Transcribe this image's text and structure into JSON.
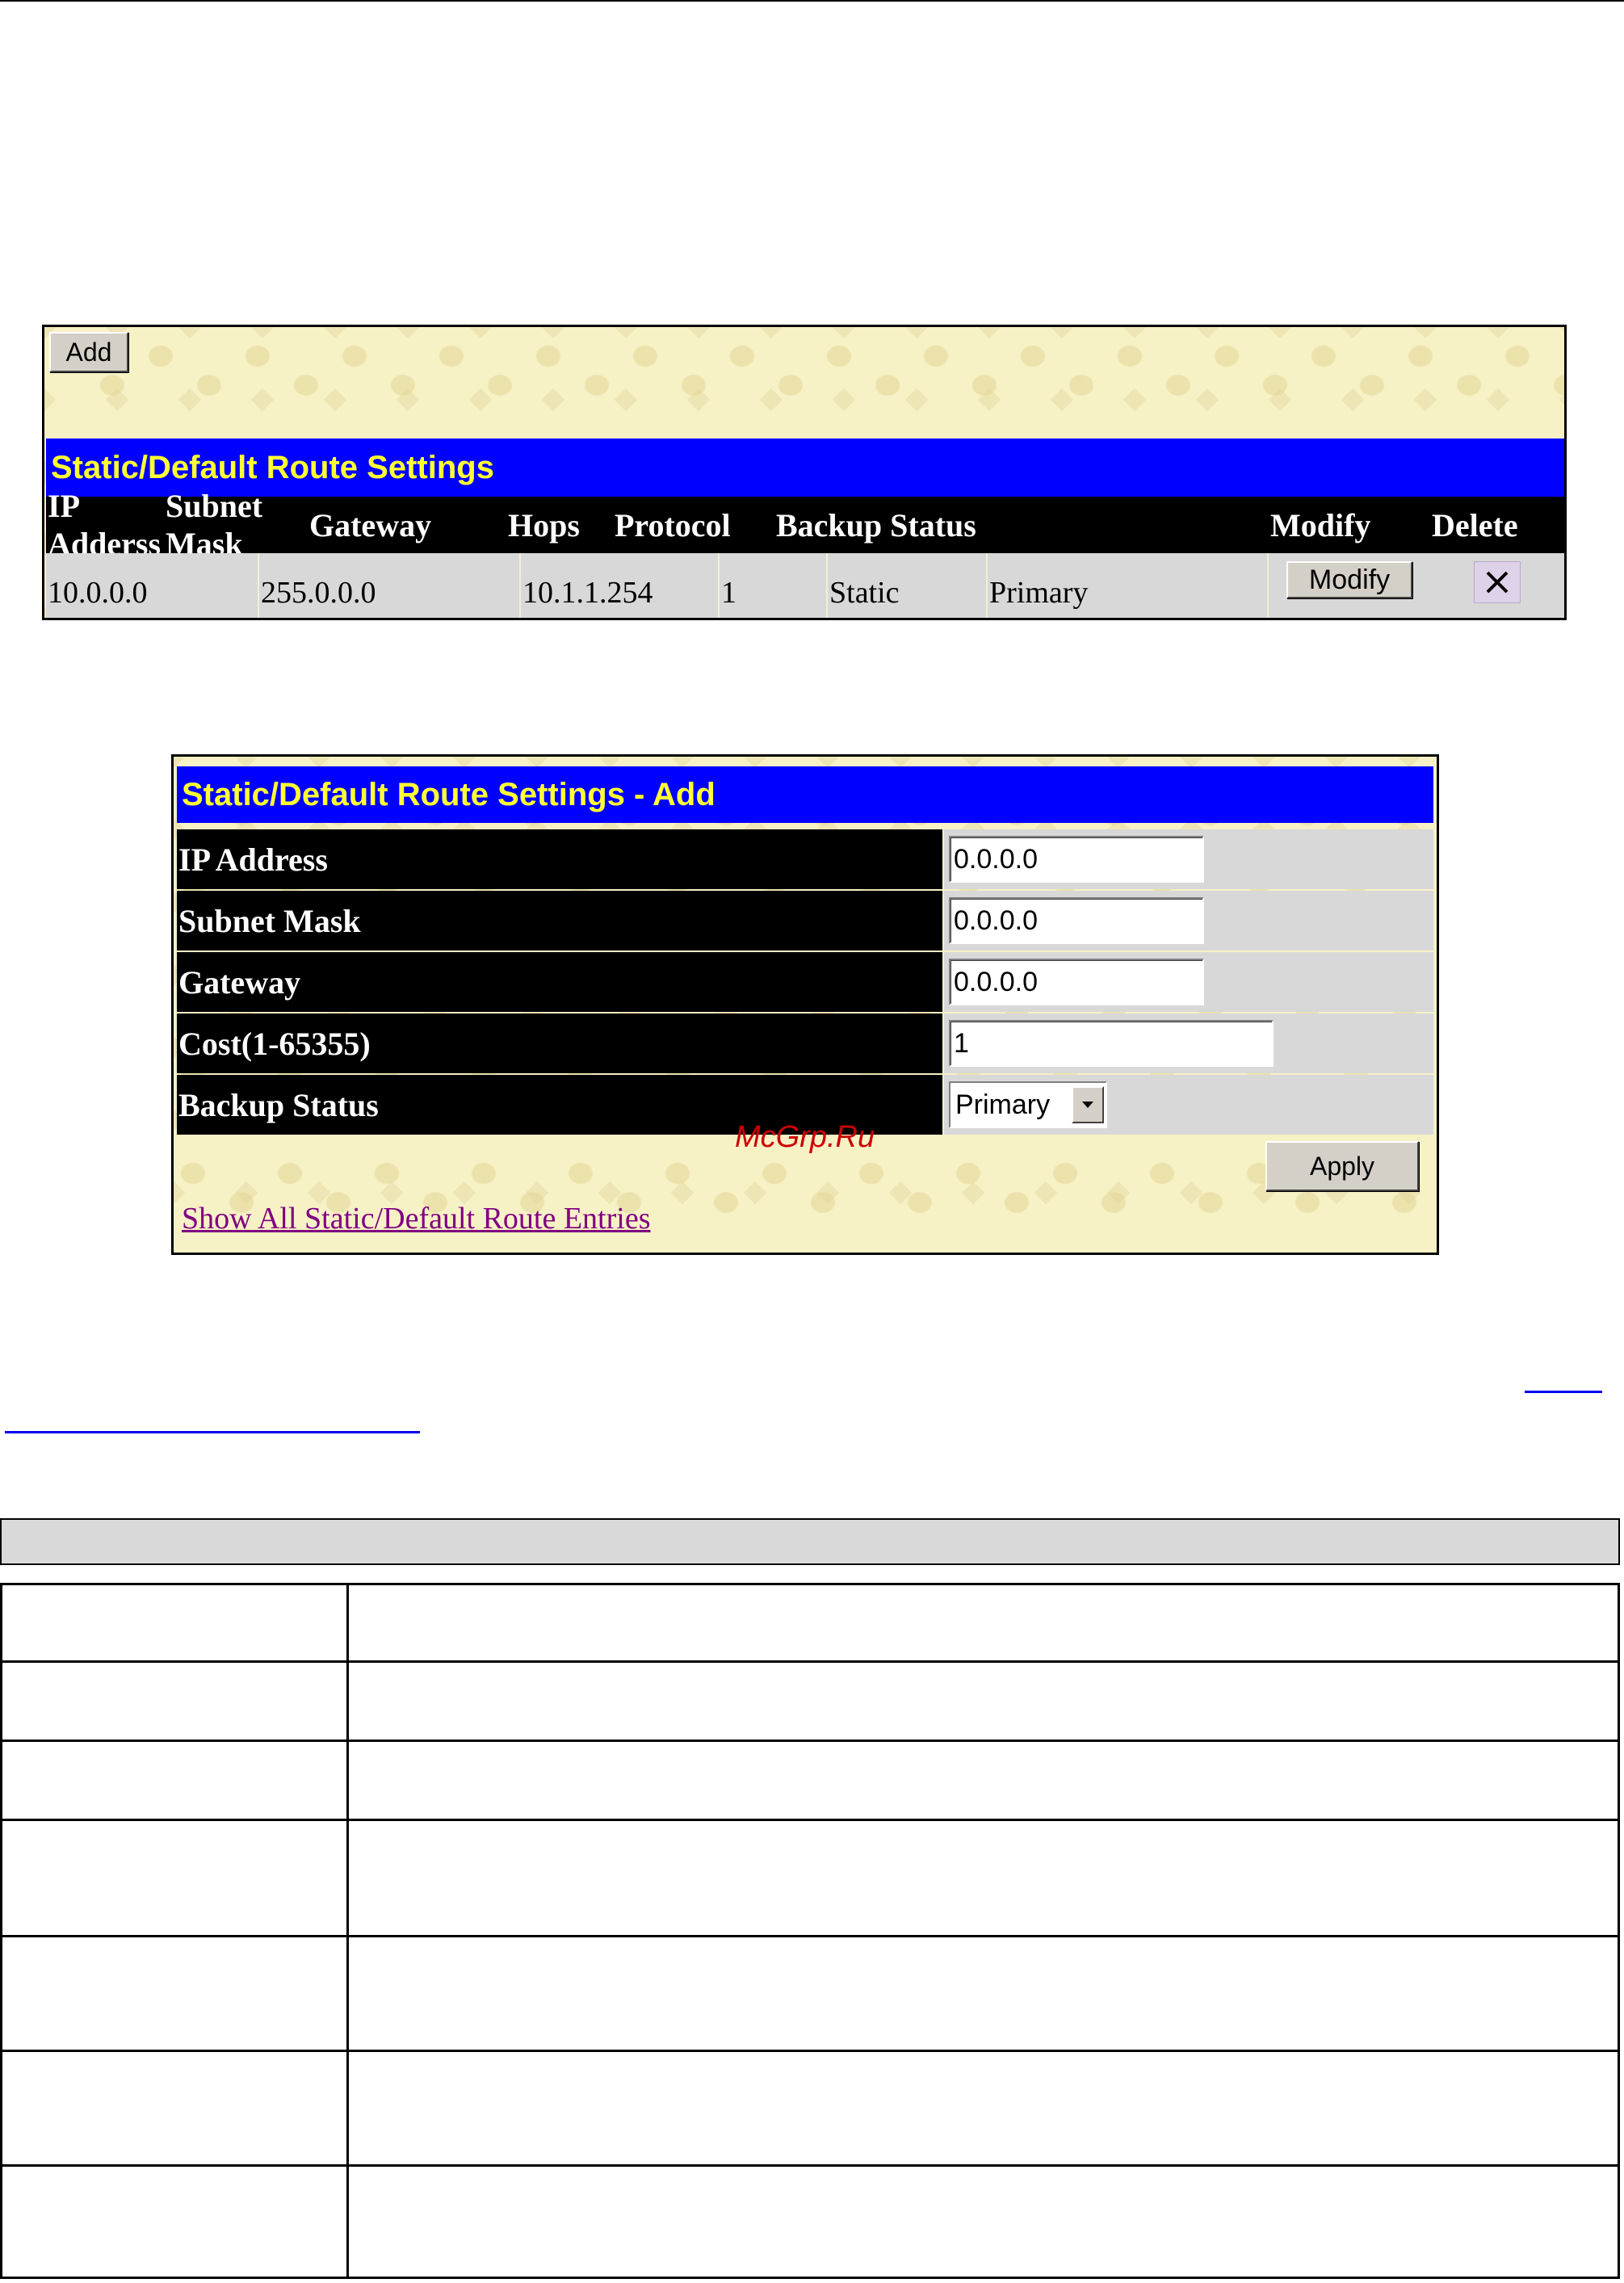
{
  "panel_list": {
    "add_label": "Add",
    "title": "Static/Default Route Settings",
    "columns": [
      "IP Adderss",
      "Subnet Mask",
      "Gateway",
      "Hops",
      "Protocol",
      "Backup Status",
      "Modify",
      "Delete"
    ],
    "rows": [
      {
        "ip": "10.0.0.0",
        "mask": "255.0.0.0",
        "gateway": "10.1.1.254",
        "hops": "1",
        "protocol": "Static",
        "backup_status": "Primary",
        "modify_label": "Modify",
        "delete_icon": "x-icon"
      }
    ]
  },
  "panel_add": {
    "title": "Static/Default Route Settings - Add",
    "fields": [
      {
        "label": "IP Address",
        "value": "0.0.0.0"
      },
      {
        "label": "Subnet Mask",
        "value": "0.0.0.0"
      },
      {
        "label": "Gateway",
        "value": "0.0.0.0"
      },
      {
        "label": "Cost(1-65355)",
        "value": "1"
      },
      {
        "label": "Backup Status",
        "value": "Primary"
      }
    ],
    "apply_label": "Apply",
    "show_all_link": "Show All Static/Default Route Entries"
  },
  "watermark": "McGrp.Ru",
  "colors": {
    "title_bar": "#0000ff",
    "title_text": "#ffff33",
    "header_bg": "#000000",
    "row_bg": "#d8d8d8",
    "panel_bg": "#f7f1c6",
    "link": "#800080"
  }
}
